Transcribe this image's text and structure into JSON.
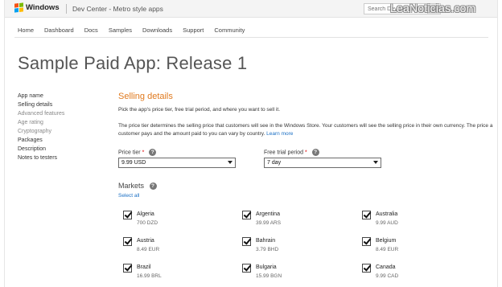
{
  "header": {
    "brand": "Windows",
    "flag_colors": [
      "#f65314",
      "#7cbb00",
      "#00a1f1",
      "#ffbb00"
    ],
    "section": "Dev Center - Metro style apps",
    "search_placeholder": "Search Dev Center",
    "watermark": "LeaNoticias.com"
  },
  "nav": {
    "items": [
      "Home",
      "Dashboard",
      "Docs",
      "Samples",
      "Downloads",
      "Support",
      "Community"
    ]
  },
  "page_title": "Sample Paid App: Release 1",
  "left_menu": [
    {
      "label": "App name",
      "dim": false
    },
    {
      "label": "Selling details",
      "dim": false
    },
    {
      "label": "Advanced features",
      "dim": true
    },
    {
      "label": "Age rating",
      "dim": true
    },
    {
      "label": "Cryptography",
      "dim": true
    },
    {
      "label": "Packages",
      "dim": false
    },
    {
      "label": "Description",
      "dim": false
    },
    {
      "label": "Notes to testers",
      "dim": false
    }
  ],
  "selling": {
    "title": "Selling details",
    "intro": "Pick the app's price tier, free trial period, and where you want to sell it.",
    "description": "The price tier determines the selling price that customers will see in the Windows Store. Your customers will see the selling price in their own currency. The price a customer pays and the amount paid to you can vary by country.",
    "learn_more": "Learn more",
    "price_tier_label": "Price tier",
    "price_tier_value": "9.99 USD",
    "trial_label": "Free trial period",
    "trial_value": "7 day",
    "required_mark": "*",
    "help_glyph": "?",
    "markets_label": "Markets",
    "select_all": "Select all",
    "accent_color": "#e07a1f",
    "link_color": "#1a6fc4"
  },
  "markets": [
    {
      "name": "Algeria",
      "price": "700 DZD",
      "checked": true
    },
    {
      "name": "Argentina",
      "price": "39.99 ARS",
      "checked": true
    },
    {
      "name": "Australia",
      "price": "9.99 AUD",
      "checked": true
    },
    {
      "name": "Austria",
      "price": "8.49 EUR",
      "checked": true
    },
    {
      "name": "Bahrain",
      "price": "3.79 BHD",
      "checked": true
    },
    {
      "name": "Belgium",
      "price": "8.49 EUR",
      "checked": true
    },
    {
      "name": "Brazil",
      "price": "16.99 BRL",
      "checked": true
    },
    {
      "name": "Bulgaria",
      "price": "15.99 BGN",
      "checked": true
    },
    {
      "name": "Canada",
      "price": "9.99 CAD",
      "checked": true
    }
  ]
}
